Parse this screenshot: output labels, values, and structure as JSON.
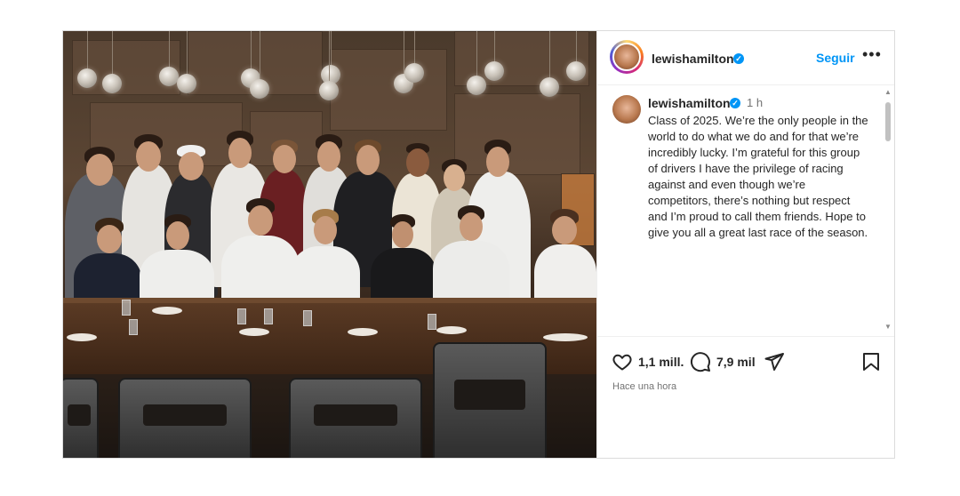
{
  "post": {
    "author": {
      "username": "lewishamilton",
      "verified": true
    },
    "follow_label": "Seguir",
    "more_label": "•••",
    "caption": {
      "username": "lewishamilton",
      "time": "1 h",
      "text": "Class of 2025. We’re the only people in the world to do what we do and for that we’re incredibly lucky. I’m grateful for this group of drivers I have the privilege of racing against and even though we’re competitors, there’s nothing but respect and I’m proud to call them friends. Hope to give you all a great last race of the season."
    },
    "stats": {
      "likes": "1,1 mill.",
      "comments": "7,9 mil"
    },
    "posted_ago": "Hace una hora"
  },
  "icons": {
    "verified": "verified-badge-icon",
    "like": "heart-icon",
    "comment": "comment-bubble-icon",
    "share": "paper-plane-icon",
    "save": "bookmark-icon",
    "scroll_up": "triangle-up-icon",
    "scroll_down": "triangle-down-icon"
  },
  "colors": {
    "link_blue": "#0095f6",
    "verified_blue": "#0095f6",
    "text": "#262626",
    "muted": "#737373",
    "border": "#dbdbdb"
  }
}
